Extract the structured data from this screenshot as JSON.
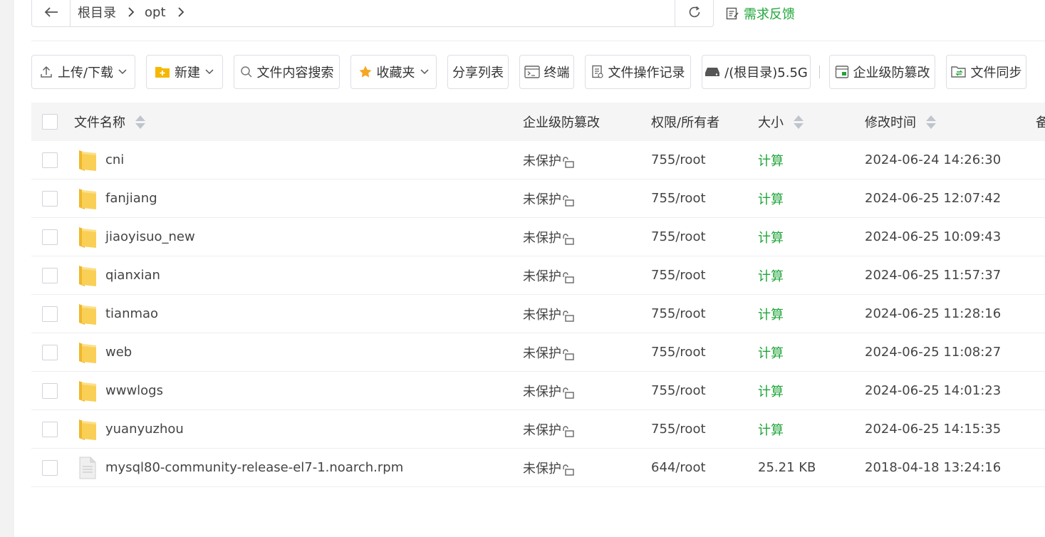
{
  "path": {
    "crumbs": [
      {
        "label": "根目录"
      },
      {
        "label": "opt"
      }
    ]
  },
  "feedback": {
    "label": "需求反馈"
  },
  "toolbar": {
    "upload_download": "上传/下载",
    "new": "新建",
    "content_search": "文件内容搜索",
    "favorites": "收藏夹",
    "share_list": "分享列表",
    "terminal": "终端",
    "file_log": "文件操作记录",
    "disk": "/(根目录)5.5G",
    "tamper_proof": "企业级防篡改",
    "file_sync": "文件同步"
  },
  "table": {
    "columns": {
      "name": "文件名称",
      "protect": "企业级防篡改",
      "perm": "权限/所有者",
      "size": "大小",
      "mtime": "修改时间",
      "remark": "备"
    },
    "rows": [
      {
        "name": "cni",
        "type": "folder",
        "protect": "未保护",
        "perm": "755/root",
        "size": "计算",
        "mtime": "2024-06-24 14:26:30"
      },
      {
        "name": "fanjiang",
        "type": "folder",
        "protect": "未保护",
        "perm": "755/root",
        "size": "计算",
        "mtime": "2024-06-25 12:07:42"
      },
      {
        "name": "jiaoyisuo_new",
        "type": "folder",
        "protect": "未保护",
        "perm": "755/root",
        "size": "计算",
        "mtime": "2024-06-25 10:09:43"
      },
      {
        "name": "qianxian",
        "type": "folder",
        "protect": "未保护",
        "perm": "755/root",
        "size": "计算",
        "mtime": "2024-06-25 11:57:37"
      },
      {
        "name": "tianmao",
        "type": "folder",
        "protect": "未保护",
        "perm": "755/root",
        "size": "计算",
        "mtime": "2024-06-25 11:28:16"
      },
      {
        "name": "web",
        "type": "folder",
        "protect": "未保护",
        "perm": "755/root",
        "size": "计算",
        "mtime": "2024-06-25 11:08:27"
      },
      {
        "name": "wwwlogs",
        "type": "folder",
        "protect": "未保护",
        "perm": "755/root",
        "size": "计算",
        "mtime": "2024-06-25 14:01:23"
      },
      {
        "name": "yuanyuzhou",
        "type": "folder",
        "protect": "未保护",
        "perm": "755/root",
        "size": "计算",
        "mtime": "2024-06-25 14:15:35"
      },
      {
        "name": "mysql80-community-release-el7-1.noarch.rpm",
        "type": "file",
        "protect": "未保护",
        "perm": "644/root",
        "size": "25.21 KB",
        "mtime": "2018-04-18 13:24:16"
      }
    ]
  },
  "colors": {
    "accent": "#20a53a",
    "folder": "#f9cf56",
    "border": "#dcdfe6"
  }
}
